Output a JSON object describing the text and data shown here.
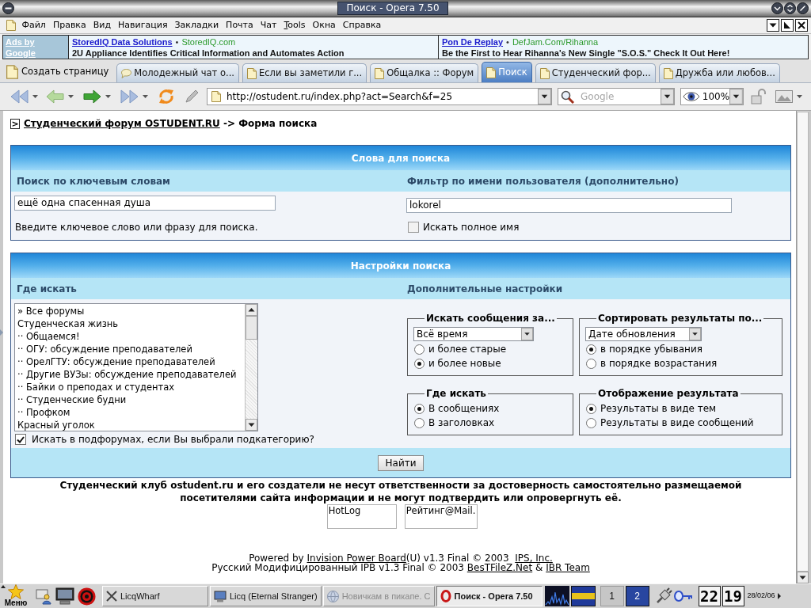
{
  "window": {
    "title": "Поиск - Opera 7.50"
  },
  "menu": [
    {
      "label": "Файл",
      "mnemonic": false
    },
    {
      "label": "Правка",
      "mnemonic": false
    },
    {
      "label": "Вид",
      "mnemonic": false
    },
    {
      "label": "Навигация",
      "mnemonic": false
    },
    {
      "label": "Закладки",
      "mnemonic": false
    },
    {
      "label": "Почта",
      "mnemonic": false
    },
    {
      "label": "Чат",
      "mnemonic": false
    },
    {
      "label": "Tools",
      "mnemonic": true
    },
    {
      "label": "Окна",
      "mnemonic": false
    },
    {
      "label": "Справка",
      "mnemonic": false
    }
  ],
  "ads": {
    "label": "Ads by Google",
    "items": [
      {
        "title": "StoredIQ Data Solutions",
        "separator": "•",
        "url": "StoredIQ.com",
        "text": "2U Appliance Identifies Critical Information and Automates Action"
      },
      {
        "title": "Pon De Replay",
        "separator": "•",
        "url": "DefJam.Com/Rihanna",
        "text": "Be the First to Hear Rihanna's New Single \"S.O.S.\" Check It Out Here!"
      }
    ]
  },
  "tabs": {
    "new_page": "Создать страницу",
    "items": [
      {
        "label": "Молодежный чат о...",
        "kind": "bubble",
        "selected": false
      },
      {
        "label": "Если вы заметили г...",
        "kind": "page",
        "selected": false
      },
      {
        "label": "Общалка :: Форум",
        "kind": "page",
        "selected": false
      },
      {
        "label": "Поиск",
        "kind": "page",
        "selected": true
      },
      {
        "label": "Студенческий фор...",
        "kind": "page",
        "selected": false
      },
      {
        "label": "Дружба или любов...",
        "kind": "page",
        "selected": false
      }
    ]
  },
  "toolbar": {
    "address": "http://ostudent.ru/index.php?act=Search&f=25",
    "search_placeholder": "Google",
    "zoom": "100%"
  },
  "page": {
    "breadcrumb": {
      "marker": ">",
      "link": "Студенческий форум OSTUDENT.RU",
      "rest": " -> Форма поиска"
    },
    "search_words": {
      "title": "Слова для поиска",
      "keywords": {
        "label": "Поиск по ключевым словам",
        "value": "ещё одна спасенная душа",
        "hint": "Введите ключевое слово или фразу для поиска."
      },
      "user": {
        "label": "Фильтр по имени пользователя (дополнительно)",
        "value": "lokorel",
        "exact": {
          "label": "Искать полное имя",
          "checked": false
        }
      }
    },
    "settings": {
      "title": "Настройки поиска",
      "where_label": "Где искать",
      "extra_label": "Дополнительные настройки",
      "forums": [
        "» Все форумы",
        "Студенческая жизнь",
        "·· Общаемся!",
        "·· ОГУ: обсуждение преподавателей",
        "·· ОрелГТУ: обсуждение преподавателей",
        "·· Другие ВУЗы: обсуждение преподавателей",
        "·· Байки о преподах и студентах",
        "·· Студенческие будни",
        "·· Профком",
        "Красный уголок"
      ],
      "subforums": {
        "label": "Искать в подфорумах, если Вы выбрали подкатегорию?",
        "checked": true
      },
      "groups": [
        {
          "legend": "Искать сообщения за...",
          "select": "Всё время",
          "options": [
            {
              "label": "и более старые",
              "selected": false
            },
            {
              "label": "и более новые",
              "selected": true
            }
          ]
        },
        {
          "legend": "Сортировать результаты по...",
          "select": "Дате обновления",
          "options": [
            {
              "label": "в порядке убывания",
              "selected": true
            },
            {
              "label": "в порядке возрастания",
              "selected": false
            }
          ]
        },
        {
          "legend": "Где искать",
          "options": [
            {
              "label": "В сообщениях",
              "selected": true
            },
            {
              "label": "В заголовках",
              "selected": false
            }
          ]
        },
        {
          "legend": "Отображение результата",
          "options": [
            {
              "label": "Результаты в виде тем",
              "selected": true
            },
            {
              "label": "Результаты в виде сообщений",
              "selected": false
            }
          ]
        }
      ],
      "submit": "Найти"
    },
    "disclaimer": "Студенческий клуб ostudent.ru и его создатели не несут ответственности за достоверность самостоятельно размещаемой посетителями сайта информации и не могут подтвердить или опровергнуть её.",
    "counters": [
      "HotLog",
      "Рейтинг@Mail."
    ],
    "footer": [
      [
        {
          "text": "Powered by ",
          "kind": "text"
        },
        {
          "text": "Invision Power Board",
          "kind": "link"
        },
        {
          "text": "(U) v1.3 Final © 2003  ",
          "kind": "text"
        },
        {
          "text": "IPS, Inc.",
          "kind": "link"
        }
      ],
      [
        {
          "text": "Русский Модифицированный IPB v1.3 Final © 2003 ",
          "kind": "text"
        },
        {
          "text": "BesTFileZ.Net",
          "kind": "link"
        },
        {
          "text": " & ",
          "kind": "text"
        },
        {
          "text": "IBR Team",
          "kind": "link"
        }
      ]
    ]
  },
  "taskbar": {
    "start": "Меню",
    "tasks": [
      {
        "label": "LicqWharf",
        "kind": "cross",
        "selected": false,
        "dimmed": false
      },
      {
        "label": "Licq (Eternal Stranger)",
        "kind": "monitor",
        "selected": false,
        "dimmed": false
      },
      {
        "label": "Новичкам в пикапе. С",
        "kind": "globe",
        "selected": false,
        "dimmed": true
      },
      {
        "label": "Поиск - Opera 7.50",
        "kind": "ring",
        "selected": true,
        "dimmed": false
      }
    ],
    "pager": [
      {
        "label": "1",
        "selected": false
      },
      {
        "label": "2",
        "selected": true
      }
    ],
    "clock": [
      "22",
      "19"
    ],
    "date": "28/02/06"
  }
}
